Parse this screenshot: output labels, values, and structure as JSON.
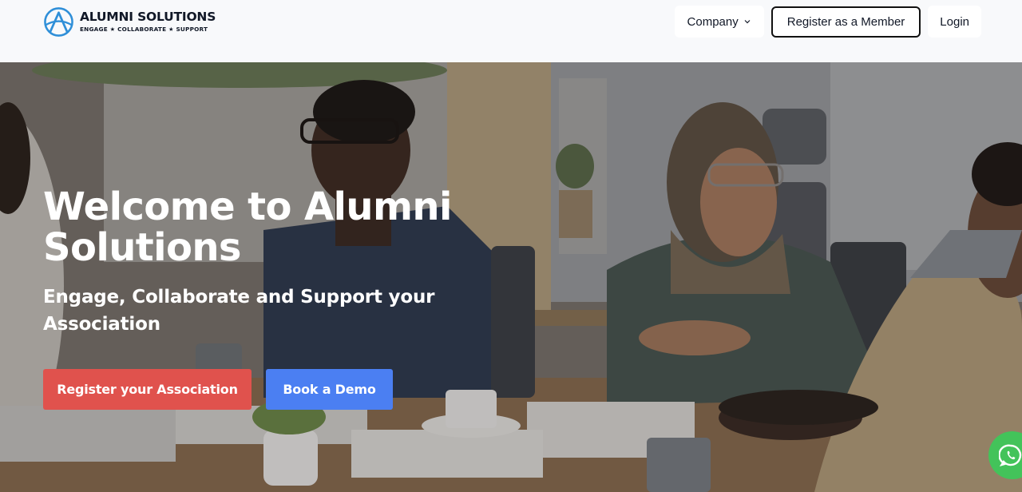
{
  "brand": {
    "name": "ALUMNI SOLUTIONS",
    "tagline": "ENGAGE ★ COLLABORATE ★ SUPPORT"
  },
  "nav": {
    "company_label": "Company",
    "register_member_label": "Register as a Member",
    "login_label": "Login"
  },
  "hero": {
    "title": "Welcome to Alumni Solutions",
    "subtitle": "Engage, Collaborate and Support your Association",
    "primary_button": "Register your Association",
    "secondary_button": "Book a Demo"
  },
  "colors": {
    "primary_red": "#e0524d",
    "accent_blue": "#4b7ff2",
    "whatsapp_green": "#43c35a",
    "logo_blue": "#2f8fd8"
  },
  "icons": [
    "chevron-down-icon",
    "whatsapp-icon"
  ]
}
